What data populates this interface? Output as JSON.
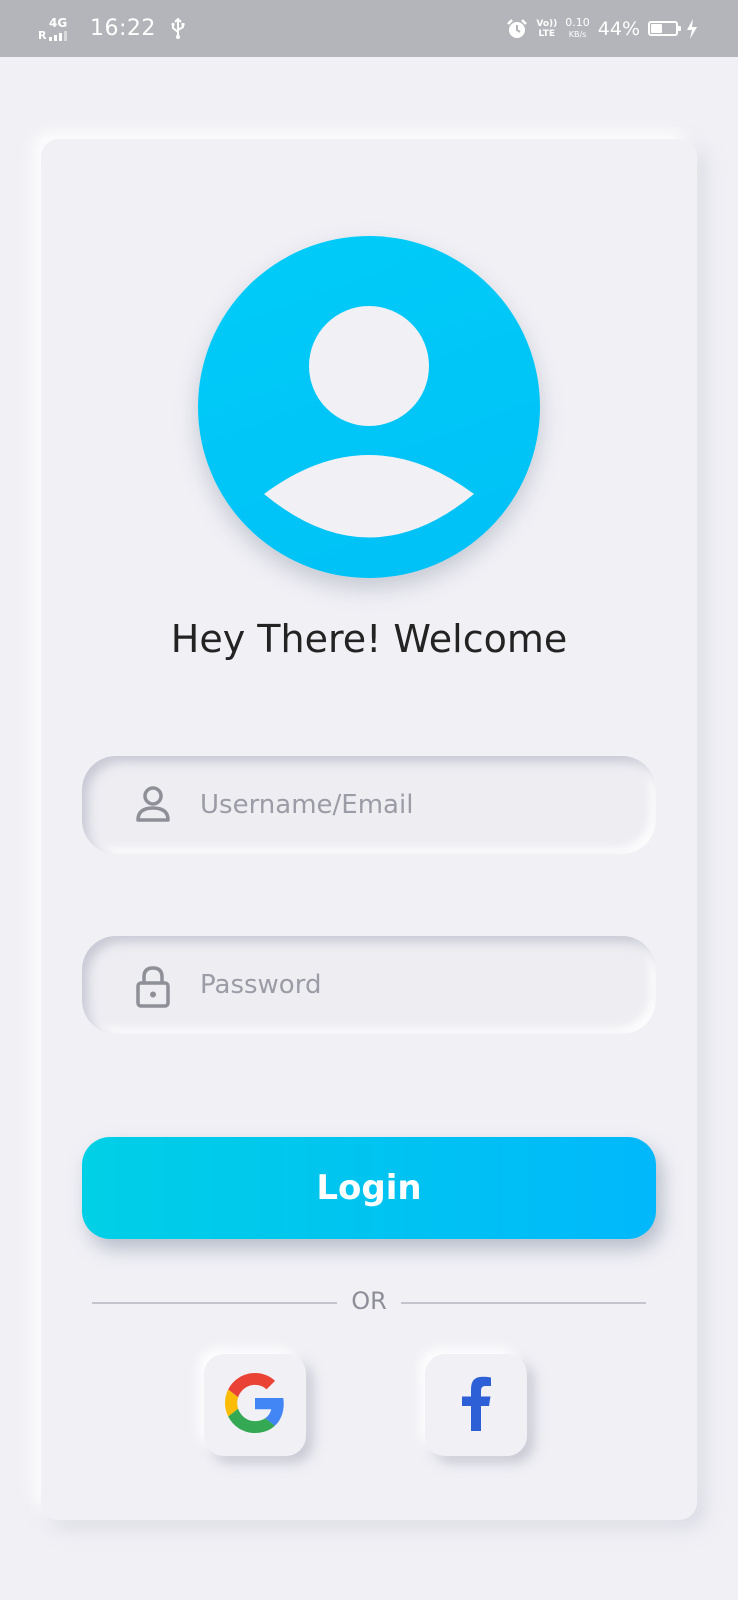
{
  "status_bar": {
    "roaming": "R",
    "network": "4G",
    "time": "16:22",
    "volte": "VoLTE",
    "volte_top": "Vo))",
    "volte_bottom": "LTE",
    "speed_value": "0.10",
    "speed_unit": "KB/s",
    "battery_percent": "44%",
    "battery_level": 0.44
  },
  "login": {
    "welcome": "Hey There! Welcome",
    "username_placeholder": "Username/Email",
    "password_placeholder": "Password",
    "login_label": "Login",
    "or_label": "OR"
  },
  "colors": {
    "accent_start": "#00d0e6",
    "accent_end": "#00b8fb",
    "avatar": "#00c4f7",
    "background": "#f0f0f5",
    "facebook": "#2d60d6"
  },
  "icons": {
    "username": "user-icon",
    "password": "lock-icon",
    "google": "google-icon",
    "facebook": "facebook-icon"
  }
}
